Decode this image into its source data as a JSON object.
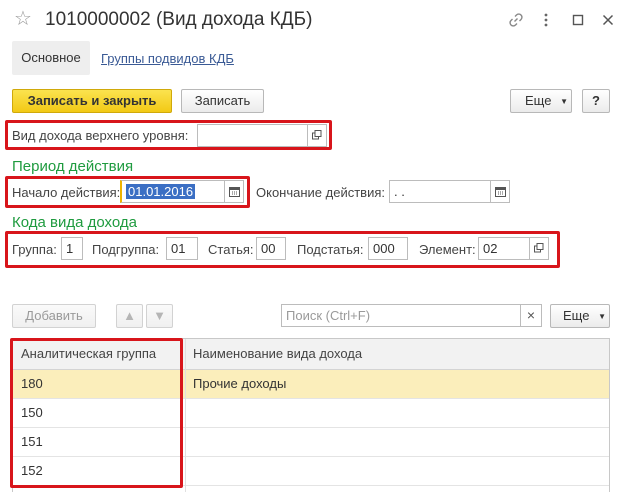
{
  "window": {
    "title": "1010000002 (Вид дохода КДБ)",
    "star_icon": "star-icon",
    "icons": [
      "link-icon",
      "more-vertical-icon",
      "maximize-icon",
      "close-icon"
    ]
  },
  "tabs": {
    "main": "Основное",
    "subgroups": "Группы подвидов КДБ"
  },
  "toolbar": {
    "save_close": "Записать и закрыть",
    "save": "Записать",
    "more": "Еще",
    "help": "?"
  },
  "top_level": {
    "label": "Вид дохода верхнего уровня:",
    "value": ""
  },
  "period": {
    "heading": "Период действия",
    "start_label": "Начало действия:",
    "start_value": "01.01.2016",
    "end_label": "Окончание действия:",
    "end_value": " .  ."
  },
  "codes": {
    "heading": "Кода вида дохода",
    "group_label": "Группа:",
    "group_value": "1",
    "subgroup_label": "Подгруппа:",
    "subgroup_value": "01",
    "article_label": "Статья:",
    "article_value": "00",
    "subarticle_label": "Подстатья:",
    "subarticle_value": "000",
    "element_label": "Элемент:",
    "element_value": "02"
  },
  "table_toolbar": {
    "add": "Добавить",
    "search_placeholder": "Поиск (Ctrl+F)",
    "clear": "×",
    "more": "Еще"
  },
  "table": {
    "headers": [
      "Аналитическая группа",
      "Наименование вида дохода"
    ],
    "rows": [
      [
        "180",
        "Прочие доходы"
      ],
      [
        "150",
        ""
      ],
      [
        "151",
        ""
      ],
      [
        "152",
        ""
      ]
    ]
  },
  "colors": {
    "primary_button": "#f2c915",
    "section_heading": "#1f9b3f",
    "highlight_box": "#d8151b",
    "selected_row": "#fbeebb",
    "link": "#3a5a95"
  }
}
